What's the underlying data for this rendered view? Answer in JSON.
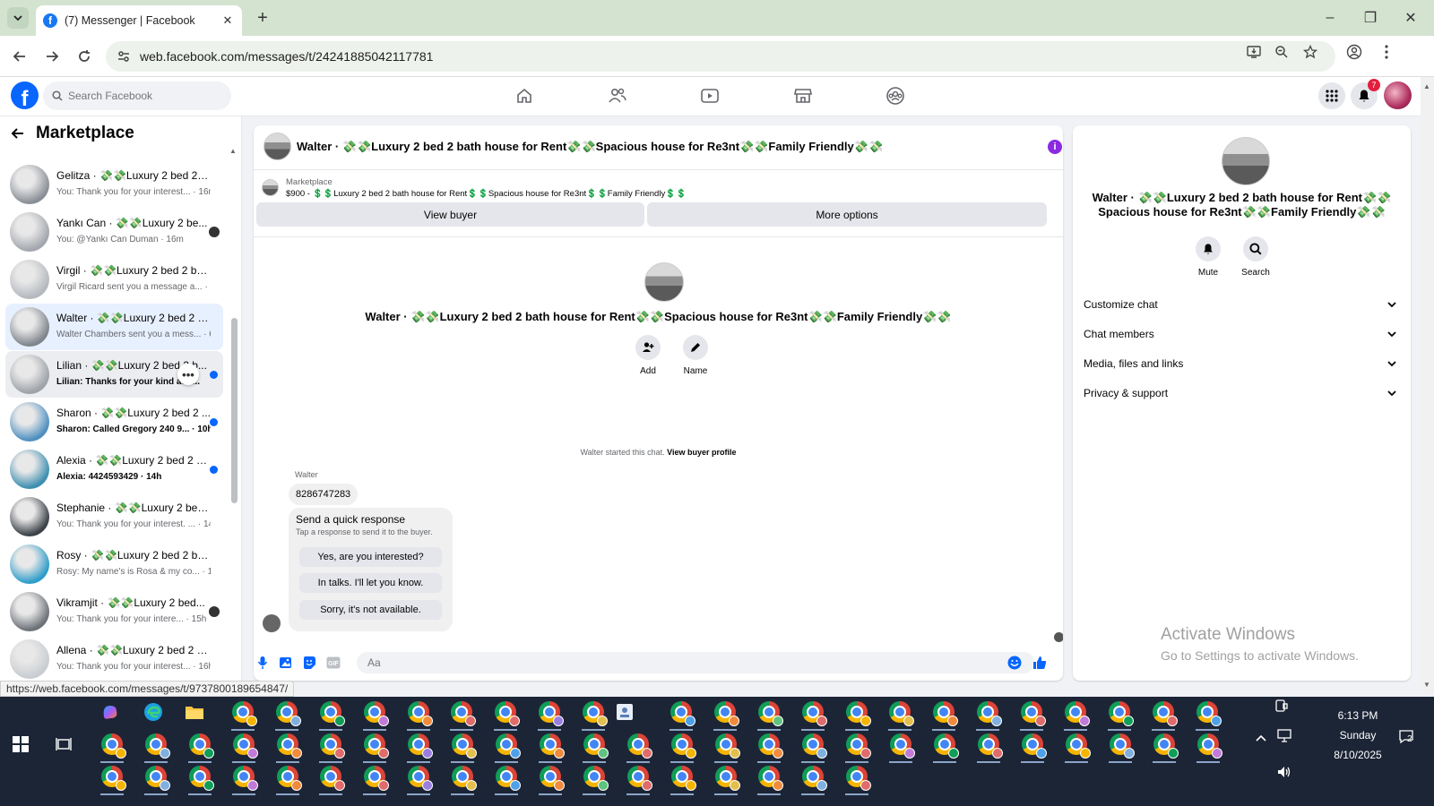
{
  "browser": {
    "tab_title": "(7) Messenger | Facebook",
    "url": "web.facebook.com/messages/t/24241885042117781",
    "status_url": "https://web.facebook.com/messages/t/9737800189654847/"
  },
  "fb": {
    "search_placeholder": "Search Facebook",
    "notification_count": "7"
  },
  "sidebar": {
    "title": "Marketplace",
    "conversations": [
      {
        "name": "Gelitza · 💸💸Luxury 2 bed 2 b...",
        "preview": "You: Thank you for your interest... · 16m",
        "unread": false,
        "status": "none",
        "avatar": "#8a8f96"
      },
      {
        "name": "Yankı Can · 💸💸Luxury 2 be...",
        "preview": "You: @Yankı Can Duman · 16m",
        "unread": false,
        "status": "seen",
        "avatar": "#a3a7ad"
      },
      {
        "name": "Virgil · 💸💸Luxury 2 bed 2 bat...",
        "preview": "Virgil Ricard sent you a message a... · 5h",
        "unread": false,
        "status": "none",
        "avatar": "#b5b9be"
      },
      {
        "name": "Walter · 💸💸Luxury 2 bed 2 ba...",
        "preview": "Walter Chambers sent you a mess... · 6h",
        "unread": false,
        "status": "none",
        "avatar": "#7f858c"
      },
      {
        "name": "Lilian · 💸💸Luxury 2 bed 2 b...",
        "preview": "Lilian: Thanks for your kind atte...",
        "unread": true,
        "status": "dot",
        "avatar": "#9ea3a8"
      },
      {
        "name": "Sharon · 💸💸Luxury 2 bed 2 ...",
        "preview": "Sharon: Called Gregory 240 9... · 10h",
        "unread": true,
        "status": "dot",
        "avatar": "#4f8fc0"
      },
      {
        "name": "Alexia · 💸💸Luxury 2 bed 2 b...",
        "preview": "Alexia: 4424593429 · 14h",
        "unread": true,
        "status": "dot",
        "avatar": "#3d8fb0"
      },
      {
        "name": "Stephanie · 💸💸Luxury 2 bed ...",
        "preview": "You: Thank you for your interest. ... · 14h",
        "unread": false,
        "status": "none",
        "avatar": "#3b4148"
      },
      {
        "name": "Rosy · 💸💸Luxury 2 bed 2 bat...",
        "preview": "Rosy: My name's is Rosa & my co... · 14h",
        "unread": false,
        "status": "none",
        "avatar": "#2f9dc9"
      },
      {
        "name": "Vikramjit · 💸💸Luxury 2 bed...",
        "preview": "You: Thank you for your intere... · 15h",
        "unread": false,
        "status": "seen",
        "avatar": "#6d7278"
      },
      {
        "name": "Allena · 💸💸Luxury 2 bed 2 ba...",
        "preview": "You: Thank you for your interest... · 16h",
        "unread": false,
        "status": "none",
        "avatar": "#c9cdd1"
      }
    ]
  },
  "chat": {
    "header_name": "Walter · 💸💸Luxury 2 bed 2 bath house for Rent💸💸Spacious house for Re3nt💸💸Family Friendly💸💸",
    "listing_label": "Marketplace",
    "listing_title": "$900 - 💲💲Luxury 2 bed 2 bath house for Rent💲💲Spacious house for Re3nt💲💲Family Friendly💲💲",
    "view_buyer": "View buyer",
    "more_options": "More options",
    "intro_name": "Walter · 💸💸Luxury 2 bed 2 bath house for Rent💸💸Spacious house for Re3nt💸💸Family Friendly💸💸",
    "add_label": "Add",
    "name_label": "Name",
    "started_text": "Walter started this chat.",
    "view_buyer_profile": "View buyer profile",
    "sender": "Walter",
    "message": "8286747283",
    "quick_title": "Send a quick response",
    "quick_sub": "Tap a response to send it to the buyer.",
    "quick_replies": [
      "Yes, are you interested?",
      "In talks. I'll let you know.",
      "Sorry, it's not available."
    ],
    "composer_placeholder": "Aa"
  },
  "details": {
    "name": "Walter · 💸💸Luxury 2 bed 2 bath house for Rent💸💸 Spacious house for Re3nt💸💸Family Friendly💸💸",
    "mute": "Mute",
    "search": "Search",
    "sections": [
      "Customize chat",
      "Chat members",
      "Media, files and links",
      "Privacy & support"
    ]
  },
  "watermark": {
    "title": "Activate Windows",
    "subtitle": "Go to Settings to activate Windows."
  },
  "taskbar": {
    "time": "6:13 PM",
    "day": "Sunday",
    "date": "8/10/2025",
    "notification_count": "2"
  }
}
